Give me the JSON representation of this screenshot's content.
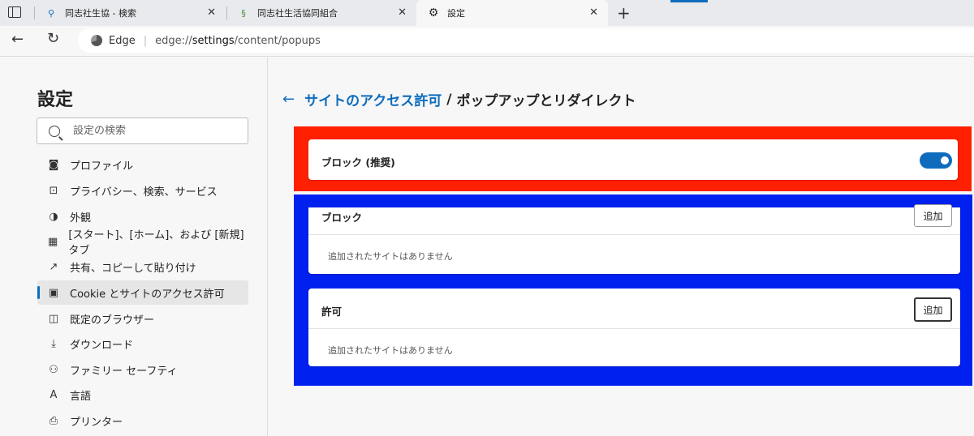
{
  "tabs": [
    {
      "title": "同志社生協 - 検索",
      "icon": "search-icon"
    },
    {
      "title": "同志社生活協同組合",
      "icon": "site-icon"
    },
    {
      "title": "設定",
      "icon": "gear-icon"
    }
  ],
  "address": {
    "brand": "Edge",
    "url_prefix": "edge://",
    "url_host": "settings",
    "url_path": "/content/popups"
  },
  "sidebar": {
    "title": "設定",
    "search_placeholder": "設定の検索",
    "items": [
      {
        "label": "プロファイル",
        "icon": "profile-icon"
      },
      {
        "label": "プライバシー、検索、サービス",
        "icon": "lock-icon"
      },
      {
        "label": "外観",
        "icon": "appearance-icon"
      },
      {
        "label": "[スタート]、[ホーム]、および [新規] タブ",
        "icon": "home-grid-icon"
      },
      {
        "label": "共有、コピーして貼り付け",
        "icon": "share-icon"
      },
      {
        "label": "Cookie とサイトのアクセス許可",
        "icon": "cookie-icon"
      },
      {
        "label": "既定のブラウザー",
        "icon": "browser-icon"
      },
      {
        "label": "ダウンロード",
        "icon": "download-icon"
      },
      {
        "label": "ファミリー セーフティ",
        "icon": "family-icon"
      },
      {
        "label": "言語",
        "icon": "language-icon"
      },
      {
        "label": "プリンター",
        "icon": "printer-icon"
      }
    ]
  },
  "breadcrumb": {
    "parent": "サイトのアクセス許可",
    "separator": "/",
    "current": "ポップアップとリダイレクト"
  },
  "block_toggle": {
    "label": "ブロック (推奨)",
    "on": true
  },
  "block_section": {
    "title": "ブロック",
    "add_label": "追加",
    "empty_text": "追加されたサイトはありません"
  },
  "allow_section": {
    "title": "許可",
    "add_label": "追加",
    "empty_text": "追加されたサイトはありません"
  },
  "colors": {
    "accent": "#0f6cbd",
    "highlight_red": "#ff2000",
    "highlight_blue": "#0020f0"
  }
}
